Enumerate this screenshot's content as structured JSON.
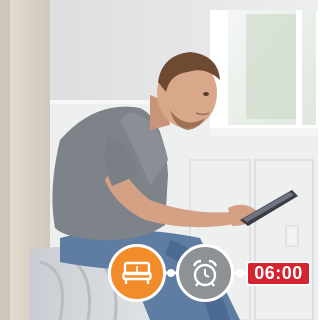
{
  "colors": {
    "bed_icon_bg": "#f28c2a",
    "alarm_icon_bg": "#8f9295",
    "time_badge_bg": "#d4242f",
    "connector": "#ffffff"
  },
  "icons": {
    "bed": "bed-icon",
    "alarm": "alarm-clock-icon"
  },
  "alarm": {
    "time": "06:00"
  }
}
